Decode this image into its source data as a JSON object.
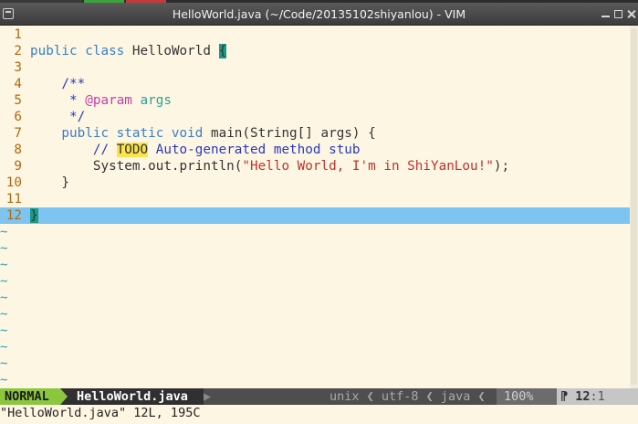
{
  "window": {
    "title": "HelloWorld.java (~/Code/20135102shiyanlou) - VIM"
  },
  "editor": {
    "cursor_line": 12,
    "tilde_char": "~",
    "tilde_rows": 10,
    "lines": [
      {
        "n": "1",
        "tokens": []
      },
      {
        "n": "2",
        "tokens": [
          [
            "kw",
            "public class "
          ],
          [
            "",
            "HelloWorld "
          ],
          [
            "brace-match",
            "{"
          ]
        ]
      },
      {
        "n": "3",
        "tokens": []
      },
      {
        "n": "4",
        "tokens": [
          [
            "cm",
            "    /**"
          ]
        ]
      },
      {
        "n": "5",
        "tokens": [
          [
            "cm",
            "     * "
          ],
          [
            "ann",
            "@param"
          ],
          [
            "cm",
            " "
          ],
          [
            "par",
            "args"
          ]
        ]
      },
      {
        "n": "6",
        "tokens": [
          [
            "cm",
            "     */"
          ]
        ]
      },
      {
        "n": "7",
        "tokens": [
          [
            "kw",
            "    public static void "
          ],
          [
            "",
            "main(String[] args) {"
          ]
        ]
      },
      {
        "n": "8",
        "tokens": [
          [
            "cm",
            "        // "
          ],
          [
            "todo",
            "TODO"
          ],
          [
            "cm",
            " Auto-generated method stub"
          ]
        ]
      },
      {
        "n": "9",
        "tokens": [
          [
            "",
            "        System.out.println("
          ],
          [
            "str",
            "\"Hello World, I'm in ShiYanLou!\""
          ],
          [
            "",
            ");"
          ]
        ]
      },
      {
        "n": "10",
        "tokens": [
          [
            "",
            "    }"
          ]
        ]
      },
      {
        "n": "11",
        "tokens": []
      },
      {
        "n": "12",
        "tokens": [
          [
            "brace-match",
            "}"
          ]
        ]
      }
    ]
  },
  "statusline": {
    "mode": "NORMAL",
    "mode_arrow": "▶",
    "filename": "HelloWorld.java",
    "filename_sep": "▶",
    "format": "unix ❮ utf-8 ❮ java ❮",
    "percent": "100%",
    "line_symbol": "⁋",
    "line": "12",
    "col": ":1"
  },
  "cmdline": {
    "text": "\"HelloWorld.java\" 12L, 195C"
  },
  "colors": {
    "background": "#fdf6e3",
    "cursorline": "#7ec4f0",
    "mode_bg": "#8cc63f",
    "line_number": "#b06a10",
    "keyword": "#3a7fc6",
    "comment": "#2a3ab7",
    "string": "#c0322d"
  }
}
